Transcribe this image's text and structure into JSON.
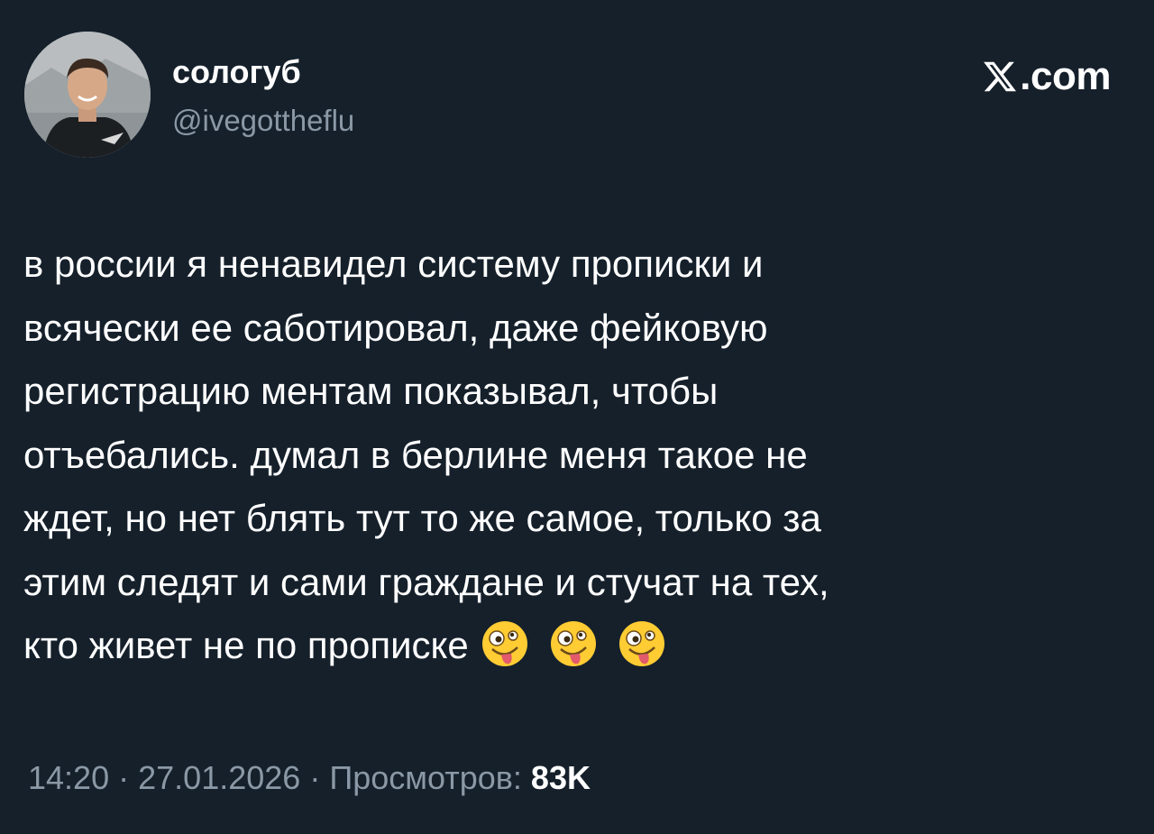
{
  "author": {
    "display_name": "сологуб",
    "handle": "@ivegottheflu",
    "avatar_icon": "person-avatar"
  },
  "brand": {
    "icon": "x-logo-icon",
    "text": ".com"
  },
  "tweet": {
    "lines": [
      "в россии я ненавидел систему прописки и",
      "всячески ее саботировал, даже фейковую",
      "регистрацию ментам показывал, чтобы",
      "отъебались. думал в берлине меня такое не",
      "ждет, но нет блять тут то же самое, только за",
      "этим следят и сами граждане и стучат на тех,",
      "кто живет не по прописке"
    ],
    "emojis": [
      "zany-face-emoji",
      "zany-face-emoji",
      "zany-face-emoji"
    ]
  },
  "meta": {
    "time": "14:20",
    "separator": "·",
    "date": "27.01.2026",
    "views_label": "Просмотров:",
    "views_count": "83K"
  },
  "colors": {
    "background": "#15202b",
    "text": "#ffffff",
    "secondary_text": "#8b98a5",
    "emoji_yellow": "#ffcc33"
  }
}
